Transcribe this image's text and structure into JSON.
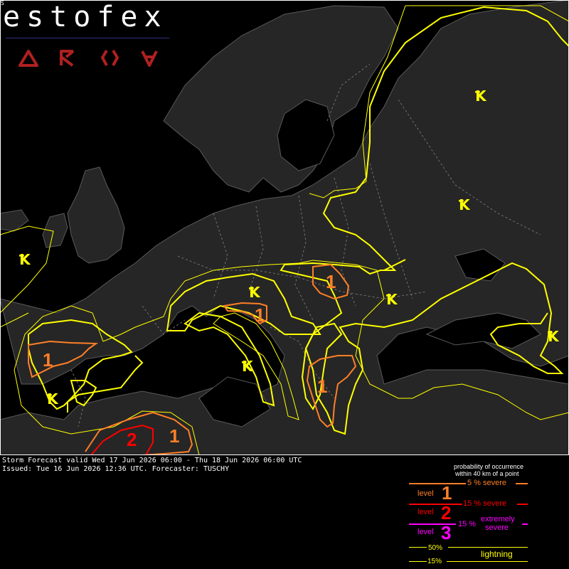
{
  "branding": {
    "name": "estofex",
    "corner_mark": "S",
    "nav_icons": [
      "triangle-icon",
      "arrow-icon",
      "brackets-icon",
      "v-icon"
    ]
  },
  "forecast": {
    "valid_line": "Storm Forecast valid Wed 17 Jun 2026 06:00 - Thu 18 Jun 2026 06:00 UTC",
    "issued_line": "Issued: Tue 16 Jun 2026 12:36 UTC. Forecaster: TUSCHY"
  },
  "map_labels": {
    "level1": "1",
    "level2": "2",
    "lightning_symbol": "Ꝁ"
  },
  "legend": {
    "header1": "probability of occurrence",
    "header2": "within 40 km of a point",
    "level_word": "level",
    "level1_num": "1",
    "level1_prob": "5 % severe",
    "level2_num": "2",
    "level2_prob": "15 % severe",
    "level3_num": "3",
    "level3_prob": "15 %",
    "level3_extreme1": "extremely",
    "level3_extreme2": "severe",
    "lightning_50": "50%",
    "lightning_label": "lightning",
    "lightning_15": "15%"
  },
  "colors": {
    "background": "#000000",
    "lightning": "#ffff00",
    "level1": "#ff7f27",
    "level2": "#ff0000",
    "level3": "#ff00ff",
    "logo_icons": "#b02020",
    "borders": "#707070"
  }
}
